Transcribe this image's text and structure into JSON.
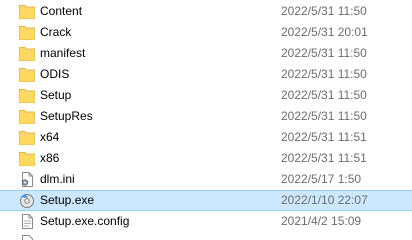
{
  "files": [
    {
      "name": "Content",
      "date": "2022/5/31 11:50",
      "icon": "folder-icon"
    },
    {
      "name": "Crack",
      "date": "2022/5/31 20:01",
      "icon": "folder-icon"
    },
    {
      "name": "manifest",
      "date": "2022/5/31 11:50",
      "icon": "folder-icon"
    },
    {
      "name": "ODIS",
      "date": "2022/5/31 11:50",
      "icon": "folder-icon"
    },
    {
      "name": "Setup",
      "date": "2022/5/31 11:50",
      "icon": "folder-icon"
    },
    {
      "name": "SetupRes",
      "date": "2022/5/31 11:50",
      "icon": "folder-icon"
    },
    {
      "name": "x64",
      "date": "2022/5/31 11:51",
      "icon": "folder-icon"
    },
    {
      "name": "x86",
      "date": "2022/5/31 11:51",
      "icon": "folder-icon"
    },
    {
      "name": "dlm.ini",
      "date": "2022/5/17 1:50",
      "icon": "settings-file-icon"
    },
    {
      "name": "Setup.exe",
      "date": "2022/1/10 22:07",
      "icon": "installer-icon",
      "selected": true
    },
    {
      "name": "Setup.exe.config",
      "date": "2021/4/2 15:09",
      "icon": "document-icon"
    }
  ],
  "colors": {
    "folder": "#f8d775",
    "folder_dark": "#e8b941",
    "selection": "#cce8ff",
    "selection_border": "#99d1ff",
    "date_text": "#6d6d6d"
  }
}
